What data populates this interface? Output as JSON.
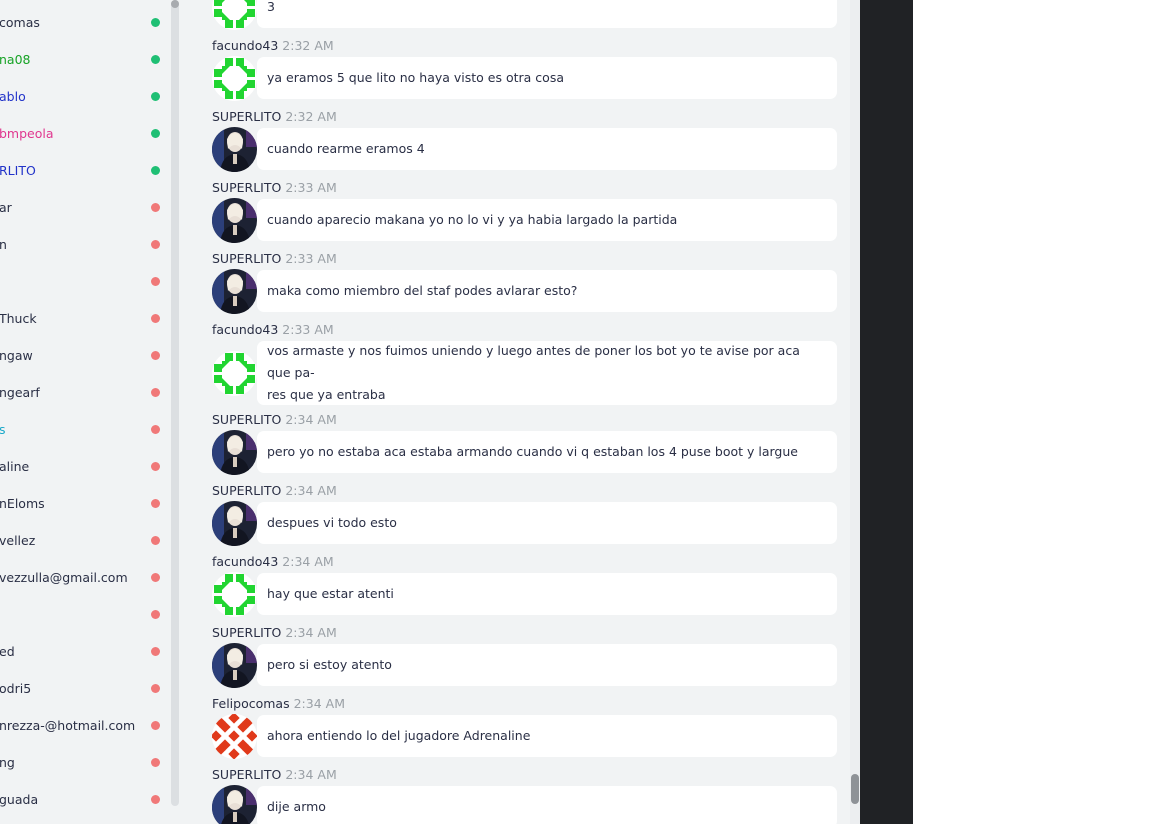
{
  "colors": {
    "online": "#1fbf74",
    "offline": "#f07878",
    "default_name": "#2a2f45",
    "timestamp": "#9aa0a6",
    "avatar_green": "#21d531",
    "avatar_red": "#e0391a"
  },
  "sidebar": {
    "users": [
      {
        "name": "comas",
        "status": "online",
        "color": "#2a2f45"
      },
      {
        "name": "na08",
        "status": "online",
        "color": "#17a326"
      },
      {
        "name": "ablo",
        "status": "online",
        "color": "#2233c9"
      },
      {
        "name": "bmpeola",
        "status": "online",
        "color": "#e0378f"
      },
      {
        "name": "RLITO",
        "status": "online",
        "color": "#2233c9"
      },
      {
        "name": "ar",
        "status": "offline",
        "color": "#2a2f45"
      },
      {
        "name": "n",
        "status": "offline",
        "color": "#2a2f45"
      },
      {
        "name": "",
        "status": "offline",
        "color": "#2a2f45"
      },
      {
        "name": "Thuck",
        "status": "offline",
        "color": "#2a2f45"
      },
      {
        "name": "ngaw",
        "status": "offline",
        "color": "#2a2f45"
      },
      {
        "name": "ngearf",
        "status": "offline",
        "color": "#2a2f45"
      },
      {
        "name": "s",
        "status": "offline",
        "color": "#1aa8c9"
      },
      {
        "name": "aline",
        "status": "offline",
        "color": "#2a2f45"
      },
      {
        "name": "nEloms",
        "status": "offline",
        "color": "#2a2f45"
      },
      {
        "name": "vellez",
        "status": "offline",
        "color": "#2a2f45"
      },
      {
        "name": "vezzulla@gmail.com",
        "status": "offline",
        "color": "#2a2f45"
      },
      {
        "name": "",
        "status": "offline",
        "color": "#2a2f45"
      },
      {
        "name": "ed",
        "status": "offline",
        "color": "#2a2f45"
      },
      {
        "name": "odri5",
        "status": "offline",
        "color": "#2a2f45"
      },
      {
        "name": "nrezza-@hotmail.com",
        "status": "offline",
        "color": "#2a2f45"
      },
      {
        "name": "ng",
        "status": "offline",
        "color": "#2a2f45"
      },
      {
        "name": "guada",
        "status": "offline",
        "color": "#2a2f45"
      }
    ]
  },
  "messages": [
    {
      "author": "",
      "time": "",
      "text": "3",
      "avatar": "green",
      "partial": true
    },
    {
      "author": "facundo43",
      "time": "2:32 AM",
      "text": "ya eramos 5 que lito no haya visto es otra cosa",
      "avatar": "green"
    },
    {
      "author": "SUPERLITO",
      "time": "2:32 AM",
      "text": "cuando rearme eramos 4",
      "avatar": "photo"
    },
    {
      "author": "SUPERLITO",
      "time": "2:33 AM",
      "text": "cuando aparecio makana yo no lo vi y ya habia largado la partida",
      "avatar": "photo"
    },
    {
      "author": "SUPERLITO",
      "time": "2:33 AM",
      "text": "maka como miembro del staf podes avlarar esto?",
      "avatar": "photo"
    },
    {
      "author": "facundo43",
      "time": "2:33 AM",
      "text": "vos armaste y nos fuimos uniendo y luego antes de poner los bot yo te avise por aca que pa-",
      "text2": "res que ya entraba",
      "avatar": "green"
    },
    {
      "author": "SUPERLITO",
      "time": "2:34 AM",
      "text": "pero yo no estaba aca estaba armando cuando vi q estaban los 4 puse boot y largue",
      "avatar": "photo"
    },
    {
      "author": "SUPERLITO",
      "time": "2:34 AM",
      "text": "despues vi todo esto",
      "avatar": "photo"
    },
    {
      "author": "facundo43",
      "time": "2:34 AM",
      "text": "hay que estar atenti",
      "avatar": "green"
    },
    {
      "author": "SUPERLITO",
      "time": "2:34 AM",
      "text": "pero si estoy atento",
      "avatar": "photo"
    },
    {
      "author": "Felipocomas",
      "time": "2:34 AM",
      "text": "ahora entiendo lo del jugadore Adrenaline",
      "avatar": "red"
    },
    {
      "author": "SUPERLITO",
      "time": "2:34 AM",
      "text": "dije armo",
      "avatar": "photo"
    }
  ]
}
